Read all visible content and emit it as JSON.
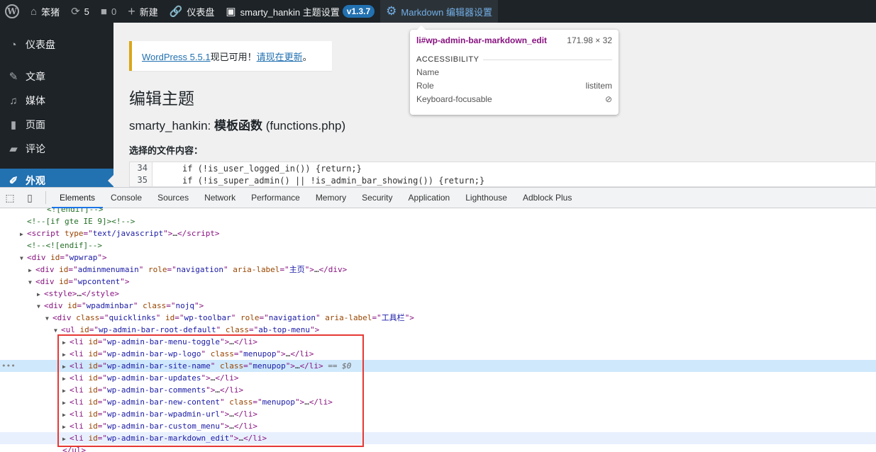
{
  "admin_bar": {
    "site_name": "笨猪",
    "updates_count": "5",
    "comments_count": "0",
    "new_label": "新建",
    "dashboard_label": "仪表盘",
    "theme_settings_label": "smarty_hankin 主题设置",
    "version": "v1.3.7",
    "markdown_label": "Markdown 编辑器设置"
  },
  "sidebar": {
    "items": [
      {
        "label": "仪表盘",
        "icon": "dashboard-icon"
      },
      {
        "label": "文章",
        "icon": "pin-icon"
      },
      {
        "label": "媒体",
        "icon": "media-icon"
      },
      {
        "label": "页面",
        "icon": "page-icon"
      },
      {
        "label": "评论",
        "icon": "comment-icon"
      },
      {
        "label": "外观",
        "icon": "brush-icon"
      }
    ]
  },
  "notice": {
    "link1": "WordPress 5.5.1",
    "text": "现已可用！",
    "link2": "请现在更新",
    "suffix": "。"
  },
  "main": {
    "title": "编辑主题",
    "file_theme": "smarty_hankin: ",
    "file_bold": "模板函数",
    "file_name": " (functions.php)",
    "content_label": "选择的文件内容：",
    "code": [
      {
        "num": "34",
        "text": "if (!is_user_logged_in()) {return;}"
      },
      {
        "num": "35",
        "text": "if (!is_super_admin() || !is_admin_bar_showing()) {return;}"
      }
    ]
  },
  "tooltip": {
    "selector": "li#wp-admin-bar-markdown_edit",
    "dims": "171.98 × 32",
    "section": "ACCESSIBILITY",
    "name_label": "Name",
    "name_value": "",
    "role_label": "Role",
    "role_value": "listitem",
    "kb_label": "Keyboard-focusable"
  },
  "devtools": {
    "tabs": [
      "Elements",
      "Console",
      "Sources",
      "Network",
      "Performance",
      "Memory",
      "Security",
      "Application",
      "Lighthouse",
      "Adblock Plus"
    ],
    "active_tab": "Elements",
    "dom": {
      "top_partial": "<![endif]-->",
      "cond": "<!--[if gte IE 9]><!-->",
      "endif": "<!--<![endif]-->",
      "script_type": "text/javascript",
      "wpwrap_id": "wpwrap",
      "adminmenu_id": "adminmenumain",
      "adminmenu_role": "navigation",
      "adminmenu_label": "主页",
      "wpcontent_id": "wpcontent",
      "wpadminbar_id": "wpadminbar",
      "wpadminbar_class": "nojq",
      "toolbar_class": "quicklinks",
      "toolbar_id": "wp-toolbar",
      "toolbar_role": "navigation",
      "toolbar_label": "工具栏",
      "ul_id": "wp-admin-bar-root-default",
      "ul_class": "ab-top-menu",
      "selected_suffix": "== $0",
      "li_items": [
        {
          "id": "wp-admin-bar-menu-toggle",
          "class": ""
        },
        {
          "id": "wp-admin-bar-wp-logo",
          "class": "menupop"
        },
        {
          "id": "wp-admin-bar-site-name",
          "class": "menupop"
        },
        {
          "id": "wp-admin-bar-updates",
          "class": ""
        },
        {
          "id": "wp-admin-bar-comments",
          "class": ""
        },
        {
          "id": "wp-admin-bar-new-content",
          "class": "menupop"
        },
        {
          "id": "wp-admin-bar-wpadmin-url",
          "class": ""
        },
        {
          "id": "wp-admin-bar-custom_menu",
          "class": ""
        },
        {
          "id": "wp-admin-bar-markdown_edit",
          "class": ""
        }
      ]
    }
  }
}
